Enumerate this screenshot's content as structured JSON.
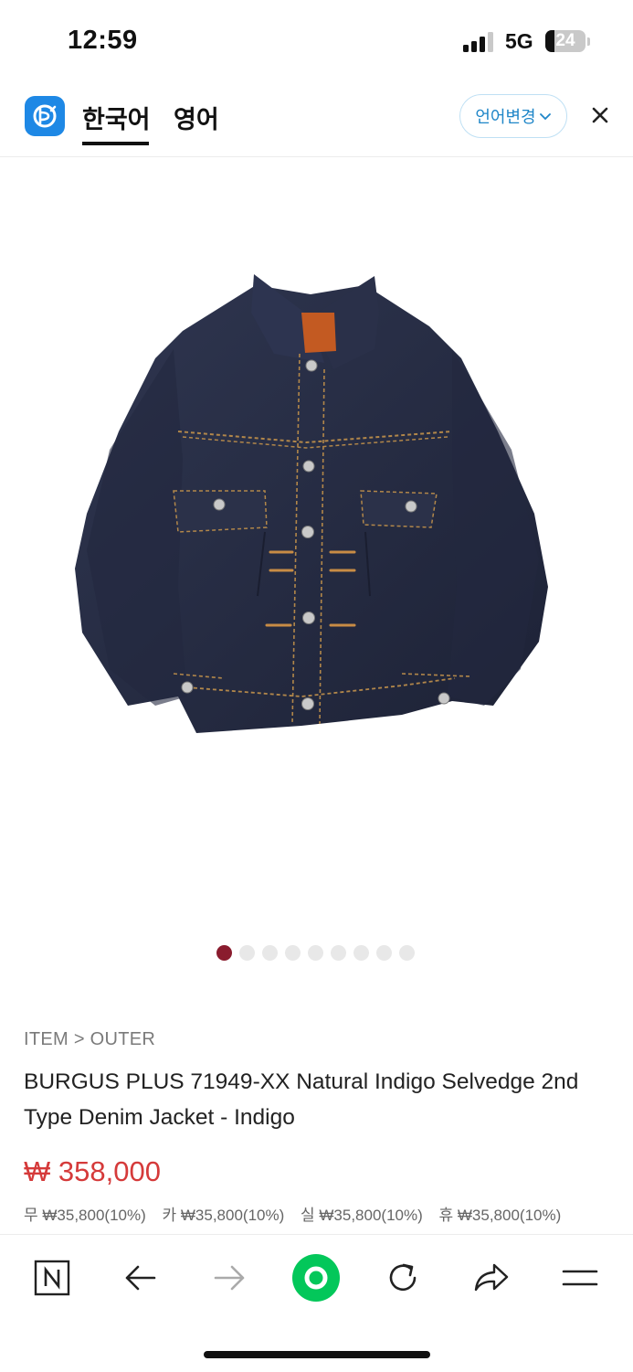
{
  "status_bar": {
    "time": "12:59",
    "network": "5G",
    "battery": "24"
  },
  "header": {
    "tabs": [
      {
        "label": "한국어",
        "active": true
      },
      {
        "label": "영어",
        "active": false
      }
    ],
    "change_language_label": "언어변경",
    "icons": {
      "logo": "translator-app-logo",
      "chevron": "chevron-down-icon",
      "close": "close-icon"
    },
    "accent_color": "#1f86c8"
  },
  "gallery": {
    "image": "indigo-denim-jacket",
    "slide_count": 9,
    "current_slide": 1,
    "active_dot_color": "#8a1c2e"
  },
  "product": {
    "breadcrumb": "ITEM > OUTER",
    "title": "BURGUS PLUS 71949-XX Natural Indigo Selvedge 2nd Type Denim Jacket - Indigo",
    "price": "₩ 358,000",
    "price_color": "#d53a3a",
    "points": [
      "무 ₩35,800(10%)",
      "카 ₩35,800(10%)",
      "실 ₩35,800(10%)",
      "휴 ₩35,800(10%)"
    ]
  },
  "bottom_nav": {
    "icons": [
      "naver-n-icon",
      "back-arrow-icon",
      "forward-arrow-icon",
      "green-home-icon",
      "reload-icon",
      "share-icon",
      "menu-icon"
    ],
    "home_color": "#03c75a"
  }
}
